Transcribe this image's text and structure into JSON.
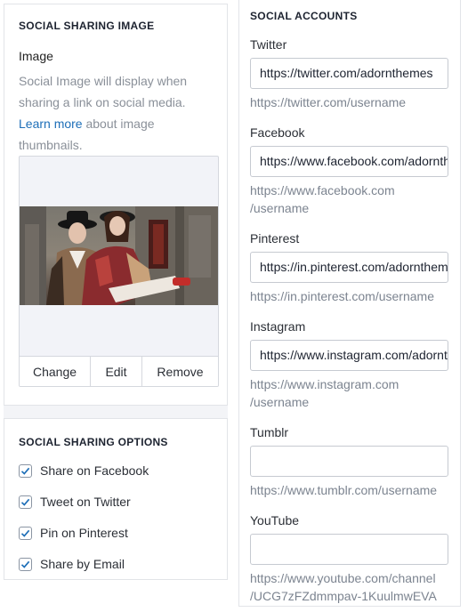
{
  "social_image": {
    "title": "SOCIAL SHARING IMAGE",
    "label": "Image",
    "desc_pre": "Social Image will display when sharing a link on social media.",
    "learn_more": "Learn more",
    "desc_post": " about image thumbnails.",
    "buttons": {
      "change": "Change",
      "edit": "Edit",
      "remove": "Remove"
    }
  },
  "sharing_options": {
    "title": "SOCIAL SHARING OPTIONS",
    "items": [
      {
        "label": "Share on Facebook",
        "checked": true
      },
      {
        "label": "Tweet on Twitter",
        "checked": true
      },
      {
        "label": "Pin on Pinterest",
        "checked": true
      },
      {
        "label": "Share by Email",
        "checked": true
      }
    ]
  },
  "social_accounts": {
    "title": "SOCIAL ACCOUNTS",
    "fields": [
      {
        "label": "Twitter",
        "value": "https://twitter.com/adornthemes",
        "hint_1": "https://twitter.com/username",
        "hint_2": ""
      },
      {
        "label": "Facebook",
        "value": "https://www.facebook.com/adornthemes",
        "hint_1": "https://www.facebook.com",
        "hint_2": "/username"
      },
      {
        "label": "Pinterest",
        "value": "https://in.pinterest.com/adornthemes",
        "hint_1": "https://in.pinterest.com/username",
        "hint_2": ""
      },
      {
        "label": "Instagram",
        "value": "https://www.instagram.com/adornthemes",
        "hint_1": "https://www.instagram.com",
        "hint_2": "/username"
      },
      {
        "label": "Tumblr",
        "value": "",
        "hint_1": "https://www.tumblr.com/username",
        "hint_2": ""
      },
      {
        "label": "YouTube",
        "value": "",
        "hint_1": "https://www.youtube.com/channel",
        "hint_2": "/UCG7zFZdmmpav-1KuulmwEVA"
      }
    ]
  },
  "colors": {
    "link": "#1e6fb8",
    "check": "#1e6fb8",
    "hint": "#7c8490"
  },
  "icons": {
    "checkbox": "check-icon"
  }
}
